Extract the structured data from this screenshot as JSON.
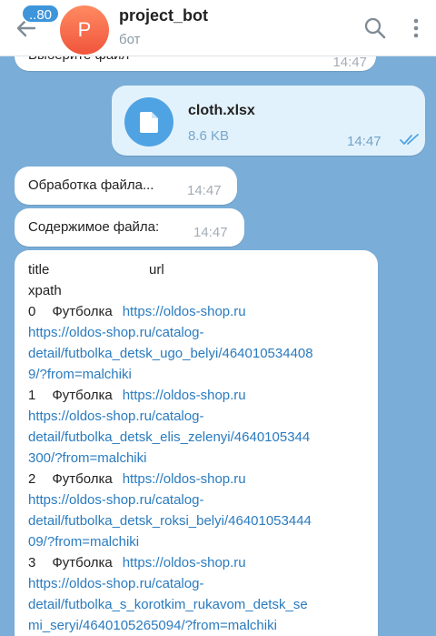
{
  "header": {
    "back_badge": "..80",
    "avatar_letter": "P",
    "title": "project_bot",
    "subtitle": "бот"
  },
  "messages": {
    "select_file": {
      "text": "Выберите файл",
      "time": "14:47"
    },
    "file": {
      "name": "cloth.xlsx",
      "size": "8.6 KB",
      "time": "14:47"
    },
    "processing": {
      "text": "Обработка файла...",
      "time": "14:47"
    },
    "contents_label": {
      "text": "Содержимое файла:",
      "time": "14:47"
    },
    "contents": {
      "header_title": "title",
      "header_url": "url",
      "header_xpath": "xpath",
      "rows": [
        {
          "index": "0",
          "name": "Футболка",
          "link_line1": "https://oldos-shop.ru",
          "link_line2": "https://oldos-shop.ru/catalog-",
          "link_line3": "detail/futbolka_detsk_ugo_belyi/464010534408",
          "link_line4": "9/?from=malchiki"
        },
        {
          "index": "1",
          "name": "Футболка",
          "link_line1": "https://oldos-shop.ru",
          "link_line2": "https://oldos-shop.ru/catalog-",
          "link_line3": "detail/futbolka_detsk_elis_zelenyi/4640105344",
          "link_line4": "300/?from=malchiki"
        },
        {
          "index": "2",
          "name": "Футболка",
          "link_line1": "https://oldos-shop.ru",
          "link_line2": "https://oldos-shop.ru/catalog-",
          "link_line3": "detail/futbolka_detsk_roksi_belyi/46401053444",
          "link_line4": "09/?from=malchiki"
        },
        {
          "index": "3",
          "name": "Футболка",
          "link_line1": "https://oldos-shop.ru",
          "link_line2": "https://oldos-shop.ru/catalog-",
          "link_line3": "detail/futbolka_s_korotkim_rukavom_detsk_se",
          "link_line4": "mi_seryi/4640105265094/?from=malchiki"
        }
      ]
    }
  },
  "colors": {
    "chat_background": "#7aaed8",
    "link": "#2a7bbf",
    "accent": "#3e95da",
    "outgoing_bubble": "#e2f2fd"
  }
}
